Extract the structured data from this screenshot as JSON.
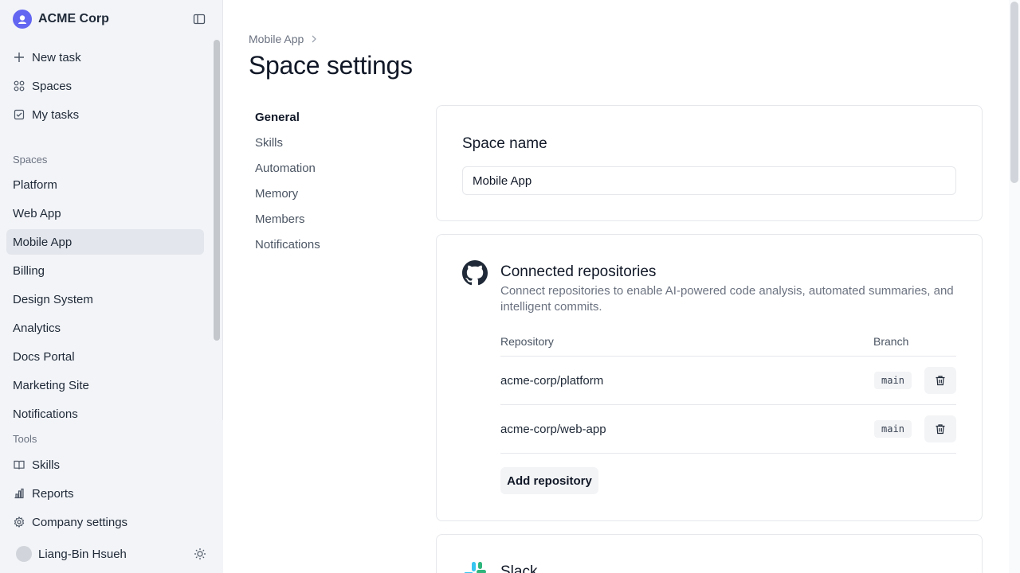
{
  "org": {
    "name": "ACME Corp"
  },
  "sidebar": {
    "actions": [
      {
        "label": "New task",
        "icon": "plus-icon"
      },
      {
        "label": "Spaces",
        "icon": "grid-icon"
      },
      {
        "label": "My tasks",
        "icon": "checkbox-icon"
      }
    ],
    "spaces_heading": "Spaces",
    "spaces": [
      {
        "label": "Platform"
      },
      {
        "label": "Web App"
      },
      {
        "label": "Mobile App",
        "active": true
      },
      {
        "label": "Billing"
      },
      {
        "label": "Design System"
      },
      {
        "label": "Analytics"
      },
      {
        "label": "Docs Portal"
      },
      {
        "label": "Marketing Site"
      },
      {
        "label": "Notifications"
      }
    ],
    "tools_heading": "Tools",
    "tools": [
      {
        "label": "Skills",
        "icon": "book-icon"
      },
      {
        "label": "Reports",
        "icon": "bar-chart-icon"
      },
      {
        "label": "Company settings",
        "icon": "gear-icon"
      }
    ],
    "user": {
      "name": "Liang-Bin Hsueh"
    }
  },
  "breadcrumb": {
    "parent": "Mobile App"
  },
  "page": {
    "title": "Space settings"
  },
  "settings_nav": [
    {
      "label": "General",
      "active": true
    },
    {
      "label": "Skills"
    },
    {
      "label": "Automation"
    },
    {
      "label": "Memory"
    },
    {
      "label": "Members"
    },
    {
      "label": "Notifications"
    }
  ],
  "space_name": {
    "title": "Space name",
    "value": "Mobile App"
  },
  "repos": {
    "title": "Connected repositories",
    "description": "Connect repositories to enable AI-powered code analysis, automated summaries, and intelligent commits.",
    "col_repository": "Repository",
    "col_branch": "Branch",
    "rows": [
      {
        "name": "acme-corp/platform",
        "branch": "main"
      },
      {
        "name": "acme-corp/web-app",
        "branch": "main"
      }
    ],
    "add_label": "Add repository"
  },
  "slack": {
    "title": "Slack"
  },
  "colors": {
    "accent": "#6366f1",
    "active_bg": "#e3e6ec",
    "sidebar_bg": "#f2f4f8"
  }
}
